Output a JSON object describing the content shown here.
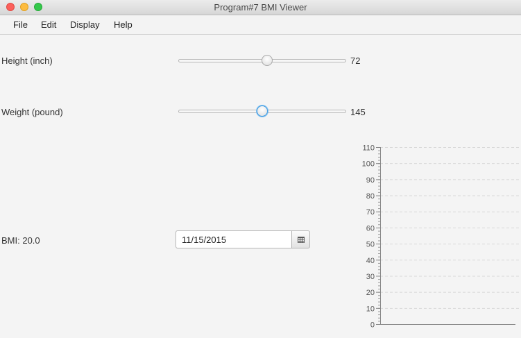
{
  "window": {
    "title": "Program#7 BMI Viewer"
  },
  "menu": [
    "File",
    "Edit",
    "Display",
    "Help"
  ],
  "height_control": {
    "label": "Height (inch)",
    "value": "72",
    "fraction": 0.53
  },
  "weight_control": {
    "label": "Weight (pound)",
    "value": "145",
    "fraction": 0.5
  },
  "bmi": {
    "label": "BMI: 20.0"
  },
  "date": {
    "value": "11/15/2015"
  },
  "chart_data": {
    "type": "bar",
    "categories": [],
    "values": [],
    "ylim": [
      0,
      110
    ],
    "yticks": [
      0,
      10,
      20,
      30,
      40,
      50,
      60,
      70,
      80,
      90,
      100,
      110
    ],
    "minor_ticks_per_major": 5,
    "grid": true
  }
}
